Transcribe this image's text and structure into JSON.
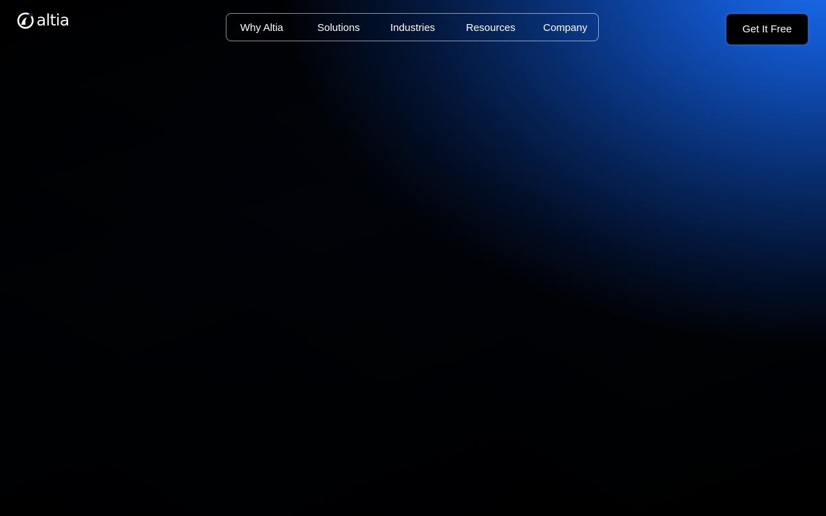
{
  "header": {
    "logo": {
      "text": "altia",
      "icon": "altia-logo-icon"
    },
    "nav": {
      "items": [
        {
          "label": "Why Altia"
        },
        {
          "label": "Solutions"
        },
        {
          "label": "Industries"
        },
        {
          "label": "Resources"
        },
        {
          "label": "Company"
        }
      ]
    },
    "cta_label": "Get It Free"
  },
  "colors": {
    "accent_blue": "#1a6cf0",
    "background": "#000000",
    "text": "#ffffff"
  }
}
